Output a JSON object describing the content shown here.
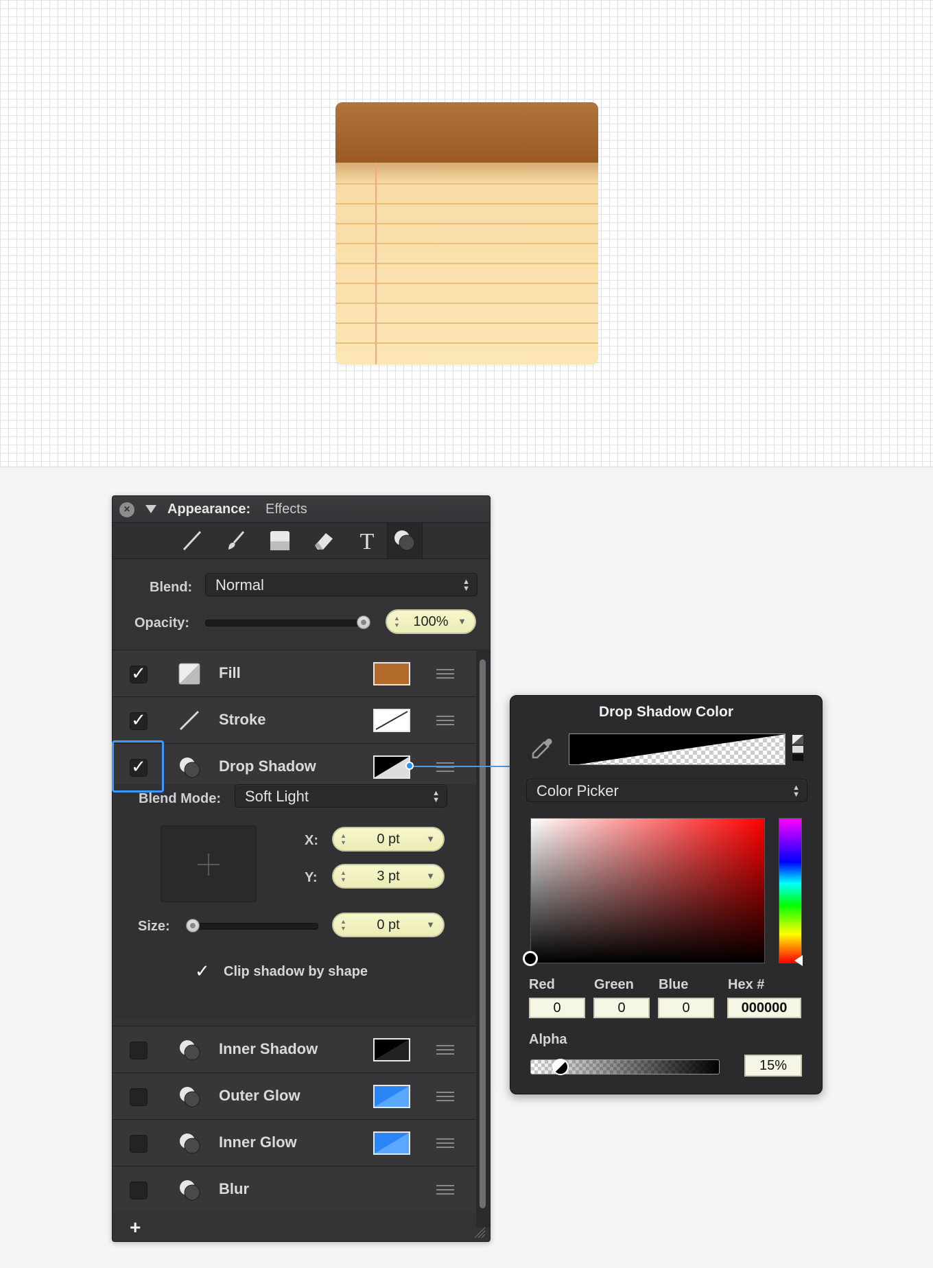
{
  "panel": {
    "title": "Appearance:",
    "subtitle": "Effects",
    "tools": [
      "stroke-tool-icon",
      "brush-tool-icon",
      "fill-tool-icon",
      "eraser-tool-icon",
      "text-tool-icon",
      "effects-tool-icon"
    ],
    "blend_label": "Blend:",
    "blend_value": "Normal",
    "opacity_label": "Opacity:",
    "opacity_value": "100%",
    "opacity_level": 1.0,
    "effects": [
      {
        "name": "Fill",
        "checked": true,
        "swatch": "#b36b2c"
      },
      {
        "name": "Stroke",
        "checked": true,
        "swatch": "none"
      },
      {
        "name": "Drop Shadow",
        "checked": true,
        "swatch": "#000000"
      },
      {
        "name": "Inner Shadow",
        "checked": false,
        "swatch": "#000000"
      },
      {
        "name": "Outer Glow",
        "checked": false,
        "swatch": "#2b86f5"
      },
      {
        "name": "Inner Glow",
        "checked": false,
        "swatch": "#2b86f5"
      },
      {
        "name": "Blur",
        "checked": false,
        "swatch": ""
      }
    ],
    "shadow": {
      "blend_mode_label": "Blend Mode:",
      "blend_mode_value": "Soft Light",
      "x_label": "X:",
      "x_value": "0 pt",
      "y_label": "Y:",
      "y_value": "3 pt",
      "size_label": "Size:",
      "size_value": "0 pt",
      "clip_label": "Clip shadow by shape",
      "clip_checked": true
    },
    "add_label": "+"
  },
  "popover": {
    "title": "Drop Shadow Color",
    "picker_mode": "Color Picker",
    "red_label": "Red",
    "red_value": "0",
    "green_label": "Green",
    "green_value": "0",
    "blue_label": "Blue",
    "blue_value": "0",
    "hex_label": "Hex #",
    "hex_value": "000000",
    "alpha_label": "Alpha",
    "alpha_value": "15%",
    "alpha_level": 0.15
  },
  "colors": {
    "accent": "#3e98ff",
    "panel_bg": "#333336",
    "notepad_header": "#a3652c",
    "notepad_paper": "#fce6b4"
  }
}
